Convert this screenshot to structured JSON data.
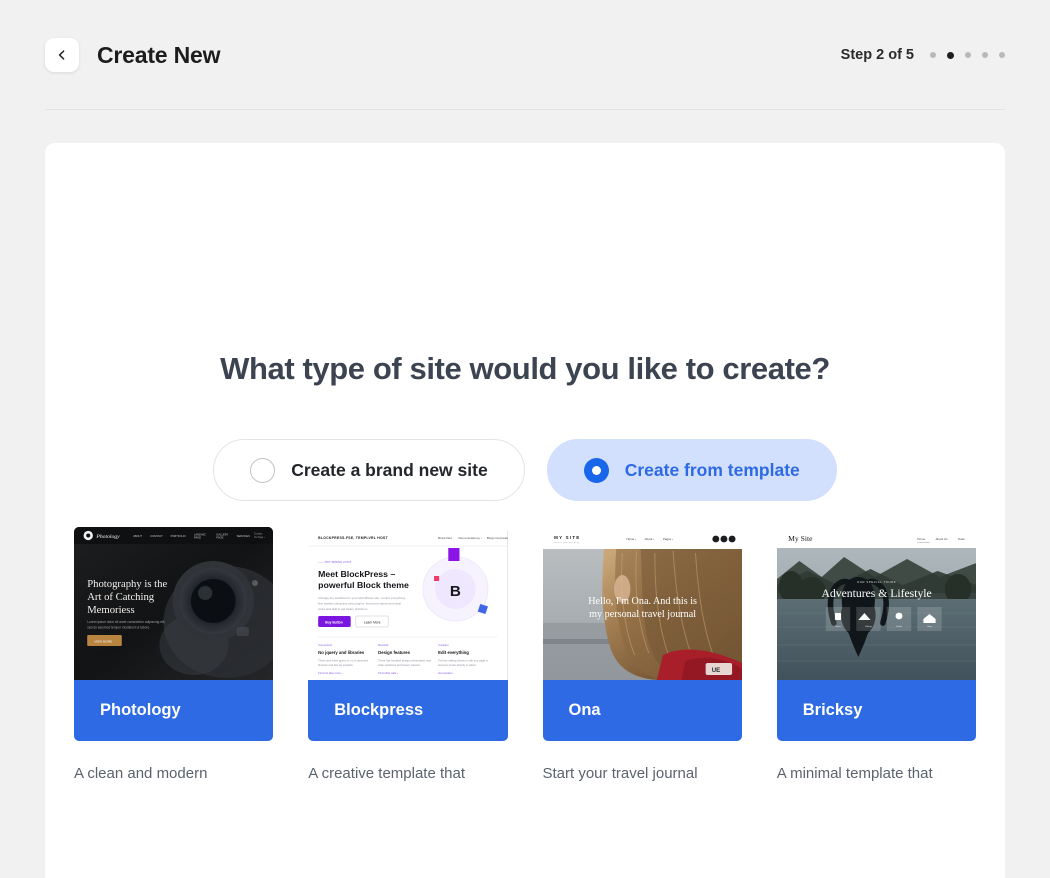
{
  "header": {
    "back_icon": "chevron-left-icon",
    "title": "Create New",
    "step_label": "Step 2 of 5",
    "total_steps": 5,
    "active_step": 2
  },
  "main": {
    "headline": "What type of site would you like to create?",
    "options": [
      {
        "label": "Create a brand new site",
        "selected": false
      },
      {
        "label": "Create from template",
        "selected": true
      }
    ]
  },
  "colors": {
    "accent_blue": "#2d6ae3",
    "radio_blue": "#1a66ea",
    "selected_pill_bg": "#d3e0fd",
    "page_bg": "#f1f1f1",
    "panel_bg": "#ffffff",
    "heading": "#3b4450",
    "description": "#5c636c"
  },
  "templates": [
    {
      "name": "Photology",
      "description": "A clean and modern",
      "preview": {
        "style": "dark",
        "logo": "Photology",
        "nav": [
          "ABOUT",
          "CONTACT",
          "PORTFOLIO",
          "LANDING PAGE",
          "GALLERY",
          "SERVICES"
        ],
        "cta_nav": "Contact Us",
        "heading": "Photography is the Art of Catching Memoriess",
        "subtext": "Lorem ipsum dolor sit amet consectetur adipiscing elit, sed do eiusmod tempor incididunt ut labore.",
        "button": "VIEW MORE",
        "button_color": "#b8843f",
        "bg_color": "#16181a"
      }
    },
    {
      "name": "Blockpress",
      "description": "A creative template that",
      "preview": {
        "style": "light",
        "logo": "BLOCKPRESS-FSE, TEMPLVRL HOST",
        "nav": [
          "Block Diet",
          "Demo Academy",
          "Blogs Corporate"
        ],
        "eyebrow": "HOT SPRING A HOT",
        "heading": "Meet BlockPress – powerful Block theme",
        "subtext": "Change the workflow for your WordPress site, control everything, fine tweaks using any new plugins. Improved speed and ideal sizes and skill to get better problems.",
        "primary_button": "Buy Button",
        "secondary_button": "Learn More",
        "primary_color": "#7b16e0",
        "badge_letter": "B",
        "features": [
          {
            "tag": "Convenient",
            "title": "No jquery and libraries",
            "body": "There dont have jquery or no in parented libraries and fast as possible.",
            "link": "Find out also more ›"
          },
          {
            "tag": "Records",
            "title": "Design features",
            "body": "There has handled design presentation and wide variations and helper classes.",
            "link": "Find other safe ›"
          },
          {
            "tag": "Curation",
            "title": "Edit everything",
            "body": "Full site editing allows to edit any page or element of site directly in editor.",
            "link": "Get started ›"
          }
        ]
      }
    },
    {
      "name": "Ona",
      "description": "Start your travel journal",
      "preview": {
        "style": "photo",
        "logo": "MY SITE",
        "logo_sub": "travel journal blog",
        "nav": [
          "Home",
          "About",
          "Pages"
        ],
        "heading": "Hello, I'm Ona. And this is my personal travel journal",
        "icon_count": 3
      }
    },
    {
      "name": "Bricksy",
      "description": "A minimal template that",
      "preview": {
        "style": "photo-serif",
        "logo": "My Site",
        "nav": [
          "Home",
          "About Us",
          "Team"
        ],
        "eyebrow": "OUR SPECIAL TOURS",
        "heading": "Adventures & Lifestyle",
        "tiles": 4
      }
    }
  ]
}
